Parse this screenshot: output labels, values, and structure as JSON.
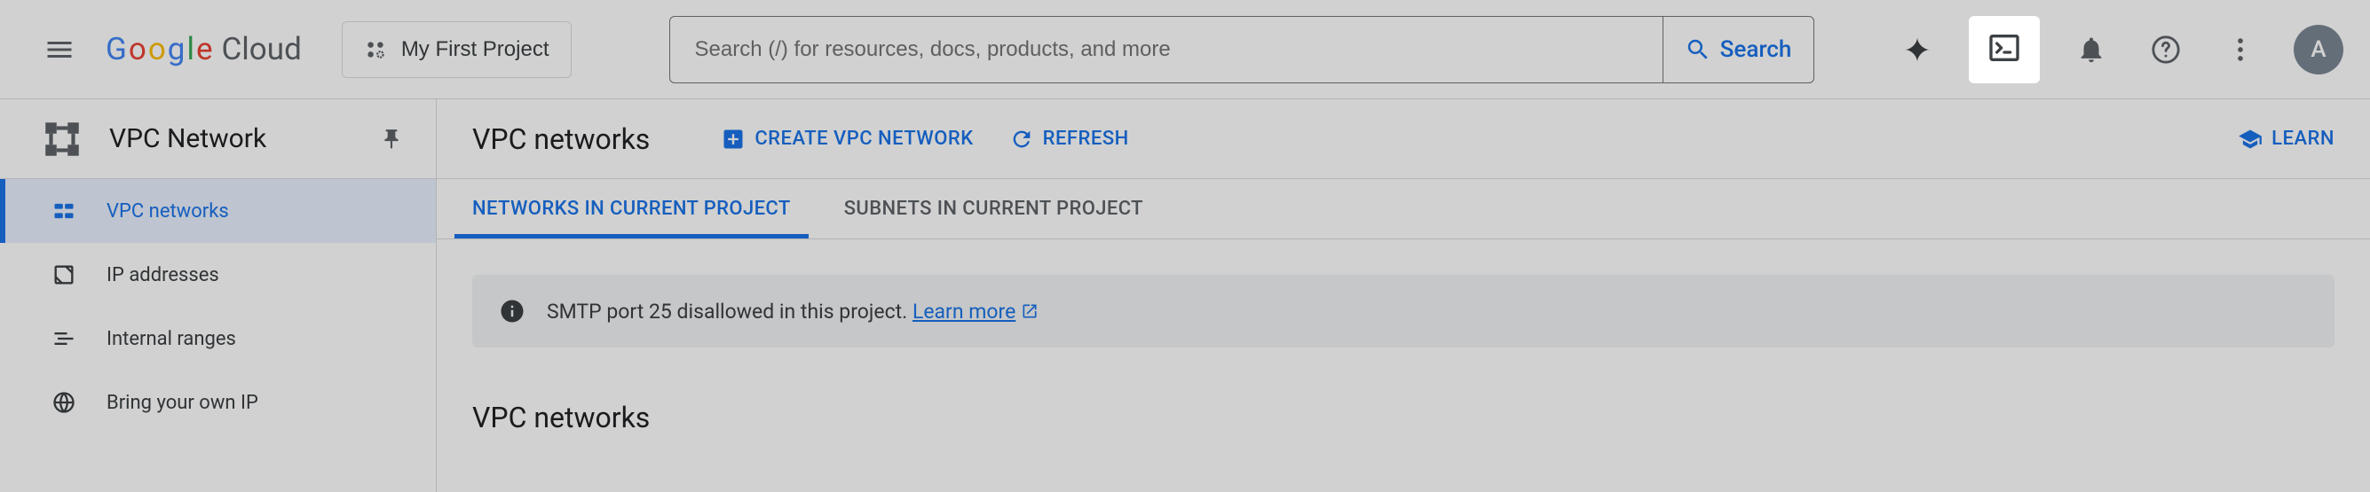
{
  "header": {
    "logo_cloud": "Cloud",
    "project_name": "My First Project",
    "search_placeholder": "Search (/) for resources, docs, products, and more",
    "search_button": "Search",
    "avatar_initial": "A"
  },
  "sidebar": {
    "title": "VPC Network",
    "items": [
      {
        "label": "VPC networks",
        "icon": "vpc-networks-icon",
        "active": true
      },
      {
        "label": "IP addresses",
        "icon": "ip-addresses-icon",
        "active": false
      },
      {
        "label": "Internal ranges",
        "icon": "internal-ranges-icon",
        "active": false
      },
      {
        "label": "Bring your own IP",
        "icon": "byoip-icon",
        "active": false
      }
    ]
  },
  "content": {
    "page_title": "VPC networks",
    "create_label": "CREATE VPC NETWORK",
    "refresh_label": "REFRESH",
    "learn_label": "LEARN",
    "tabs": [
      {
        "label": "NETWORKS IN CURRENT PROJECT",
        "active": true
      },
      {
        "label": "SUBNETS IN CURRENT PROJECT",
        "active": false
      }
    ],
    "banner_text": "SMTP port 25 disallowed in this project. ",
    "banner_link": "Learn more",
    "section_title": "VPC networks"
  }
}
